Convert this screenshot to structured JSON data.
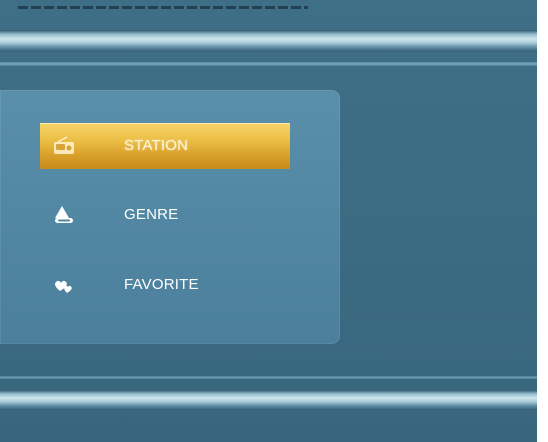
{
  "menu": {
    "items": [
      {
        "label": "STATION",
        "icon": "radio-icon",
        "selected": true
      },
      {
        "label": "GENRE",
        "icon": "genre-icon",
        "selected": false
      },
      {
        "label": "FAVORITE",
        "icon": "heart-icon",
        "selected": false
      }
    ]
  },
  "colors": {
    "background": "#3b6b82",
    "panel": "#5287a3",
    "selection": "#e0b03a",
    "text": "#ffffff"
  }
}
